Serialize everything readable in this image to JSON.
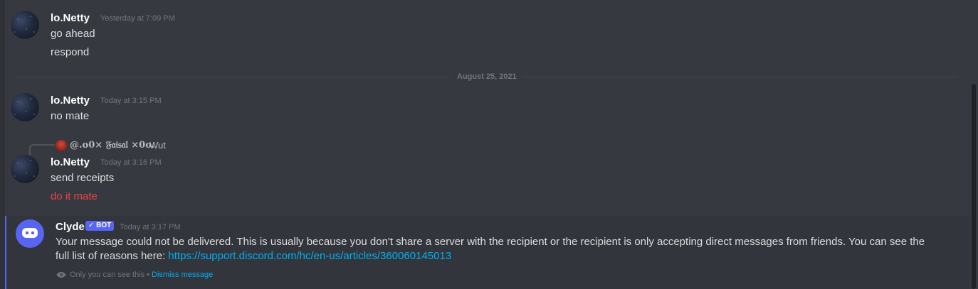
{
  "messages": [
    {
      "username": "lo.Netty",
      "timestamp": "Yesterday at 7:09 PM",
      "lines": [
        "go ahead",
        "respond"
      ]
    },
    {
      "username": "lo.Netty",
      "timestamp": "Today at 3:15 PM",
      "lines": [
        "no mate"
      ]
    },
    {
      "reply": {
        "username": "@.o0× 𝔉𝔞𝔦𝔰𝔞𝔩 ×0o.",
        "text": "Wut"
      },
      "username": "lo.Netty",
      "timestamp": "Today at 3:16 PM",
      "lines": [
        "send receipts",
        "do it mate"
      ]
    }
  ],
  "date_divider": "August 25, 2021",
  "system_message": {
    "username": "Clyde",
    "bot_tag": "✓ BOT",
    "timestamp": "Today at 3:17 PM",
    "text": "Your message could not be delivered. This is usually because you don't share a server with the recipient or the recipient is only accepting direct messages from friends. You can see the full list of reasons here: ",
    "link": "https://support.discord.com/hc/en-us/articles/360060145013",
    "ephemeral_note": "Only you can see this",
    "separator": "•",
    "dismiss_label": "Dismiss message"
  },
  "colors": {
    "background": "#36393f",
    "accent": "#5865f2",
    "link": "#00aff4",
    "error_text": "#ed4245"
  }
}
